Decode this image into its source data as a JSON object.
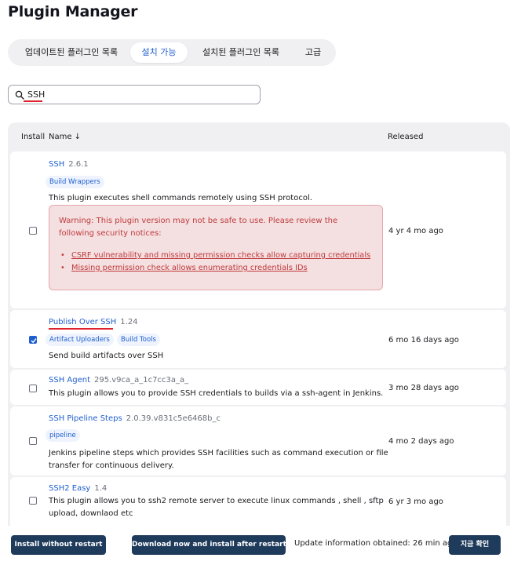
{
  "page_title": "Plugin Manager",
  "tabs": [
    {
      "label": "업데이트된 플러그인 목록"
    },
    {
      "label": "설치 가능"
    },
    {
      "label": "설치된 플러그인 목록"
    },
    {
      "label": "고급"
    }
  ],
  "active_tab": "설치 가능",
  "search": {
    "value": "SSH",
    "placeholder": ""
  },
  "table": {
    "headers": {
      "install": "Install",
      "name": "Name ↓",
      "released": "Released"
    },
    "rows": [
      {
        "name": "SSH",
        "version": "2.6.1",
        "tags": [
          "Build Wrappers"
        ],
        "description": "This plugin executes shell commands remotely using SSH protocol.",
        "warning": {
          "text": "Warning: This plugin version may not be safe to use. Please review the following security notices:",
          "links": [
            "CSRF vulnerability and missing permission checks allow capturing credentials",
            "Missing permission check allows enumerating credentials IDs"
          ]
        },
        "released": "4 yr 4 mo ago",
        "checked": false
      },
      {
        "name": "Publish Over SSH",
        "version": "1.24",
        "tags": [
          "Artifact Uploaders",
          "Build Tools"
        ],
        "description": "Send build artifacts over SSH",
        "released": "6 mo 16 days ago",
        "checked": true
      },
      {
        "name": "SSH Agent",
        "version": "295.v9ca_a_1c7cc3a_a_",
        "tags": [],
        "description": "This plugin allows you to provide SSH credentials to builds via a ssh-agent in Jenkins.",
        "released": "3 mo 28 days ago",
        "checked": false
      },
      {
        "name": "SSH Pipeline Steps",
        "version": "2.0.39.v831c5e6468b_c",
        "tags": [
          "pipeline"
        ],
        "description_lines": [
          "Jenkins pipeline steps which provides SSH facilities such as command execution or file",
          "transfer for continuous delivery."
        ],
        "released": "4 mo 2 days ago",
        "checked": false
      },
      {
        "name": "SSH2 Easy",
        "version": "1.4",
        "tags": [],
        "description_lines": [
          "This plugin allows you to ssh2 remote server to execute linux commands , shell , sftp",
          "upload, downlaod etc"
        ],
        "released": "6 yr 3 mo ago",
        "checked": false
      }
    ]
  },
  "footer": {
    "install_without_restart": "Install without restart",
    "download_install_after_restart": "Download now and install after restart",
    "update_info": "Update information obtained: 26 min ago",
    "check_now": "지금 확인"
  },
  "colors": {
    "accent": "#1f5fcf",
    "button": "#1f3b5c",
    "warning_bg": "#f4dfe1",
    "warning_text": "#bf3b3b",
    "highlight_underline": "#e0202a"
  }
}
